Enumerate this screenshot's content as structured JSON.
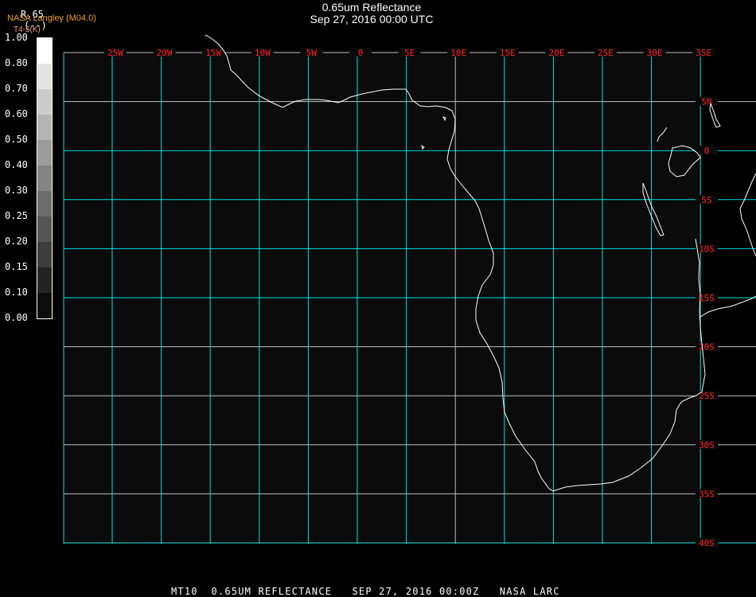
{
  "title": {
    "line1": "0.65um Reflectance",
    "line2": "Sep 27, 2016 00:00 UTC"
  },
  "legend": {
    "variable": "R.65",
    "units": "(--)",
    "organization": "NASA Langley (M04.0)",
    "secondary": "T4-5(K)",
    "ticks": [
      "1.00",
      "0.80",
      "0.70",
      "0.60",
      "0.50",
      "0.40",
      "0.30",
      "0.25",
      "0.20",
      "0.15",
      "0.10",
      "0.00"
    ],
    "colors": [
      "#ffffff",
      "#e4e4e4",
      "#cccccc",
      "#b4b4b4",
      "#9c9c9c",
      "#848484",
      "#6c6c6c",
      "#545454",
      "#3c3c3c",
      "#242424",
      "#0c0c0c"
    ]
  },
  "map": {
    "background": "#0b0b0b",
    "grid_color_primary": "#00e0e0",
    "grid_color_secondary": "#c0c0c0",
    "coast_color": "#ffffff",
    "label_color": "#ff2020",
    "lon_labels": [
      "25W",
      "20W",
      "15W",
      "10W",
      "5W",
      "0",
      "5E",
      "10E",
      "15E",
      "20E",
      "25E",
      "30E",
      "35E"
    ],
    "lat_labels": [
      "5N",
      "0",
      "5S",
      "10S",
      "15S",
      "20S",
      "25S",
      "30S",
      "35S",
      "40S"
    ]
  },
  "footer": "MT10  0.65UM REFLECTANCE   SEP 27, 2016 00:00Z   NASA LARC"
}
